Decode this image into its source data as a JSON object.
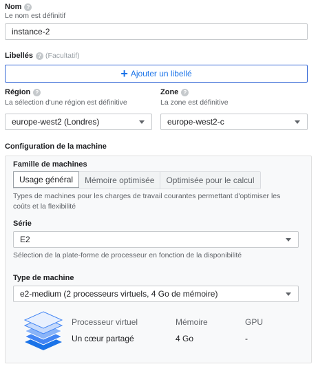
{
  "name": {
    "label": "Nom",
    "hint": "Le nom est définitif",
    "value": "instance-2"
  },
  "labels": {
    "label": "Libellés",
    "optional": "(Facultatif)",
    "add_button": "Ajouter un libellé"
  },
  "region": {
    "label": "Région",
    "hint": "La sélection d'une région est définitive",
    "value": "europe-west2 (Londres)"
  },
  "zone": {
    "label": "Zone",
    "hint": "La zone est définitive",
    "value": "europe-west2-c"
  },
  "machine_config": {
    "title": "Configuration de la machine",
    "family_label": "Famille de machines",
    "tabs": [
      {
        "label": "Usage général",
        "active": true
      },
      {
        "label": "Mémoire optimisée",
        "active": false
      },
      {
        "label": "Optimisée pour le calcul",
        "active": false
      }
    ],
    "family_description_line1": "Types de machines pour les charges de travail courantes permettant d'optimiser les",
    "family_description_line2": "coûts et la flexibilité",
    "series_label": "Série",
    "series_value": "E2",
    "series_hint": "Sélection de la plate-forme de processeur en fonction de la disponibilité",
    "machine_type_label": "Type de machine",
    "machine_type_value": "e2-medium (2 processeurs virtuels, 4 Go de mémoire)",
    "summary": {
      "icon": "layers-icon",
      "headers": [
        "Processeur virtuel",
        "Mémoire",
        "GPU"
      ],
      "values": [
        "Un cœur partagé",
        "4 Go",
        "-"
      ]
    }
  },
  "colors": {
    "accent": "#1a73e8",
    "border": "#c6c9cc",
    "icon_blue": "#4285f4"
  }
}
